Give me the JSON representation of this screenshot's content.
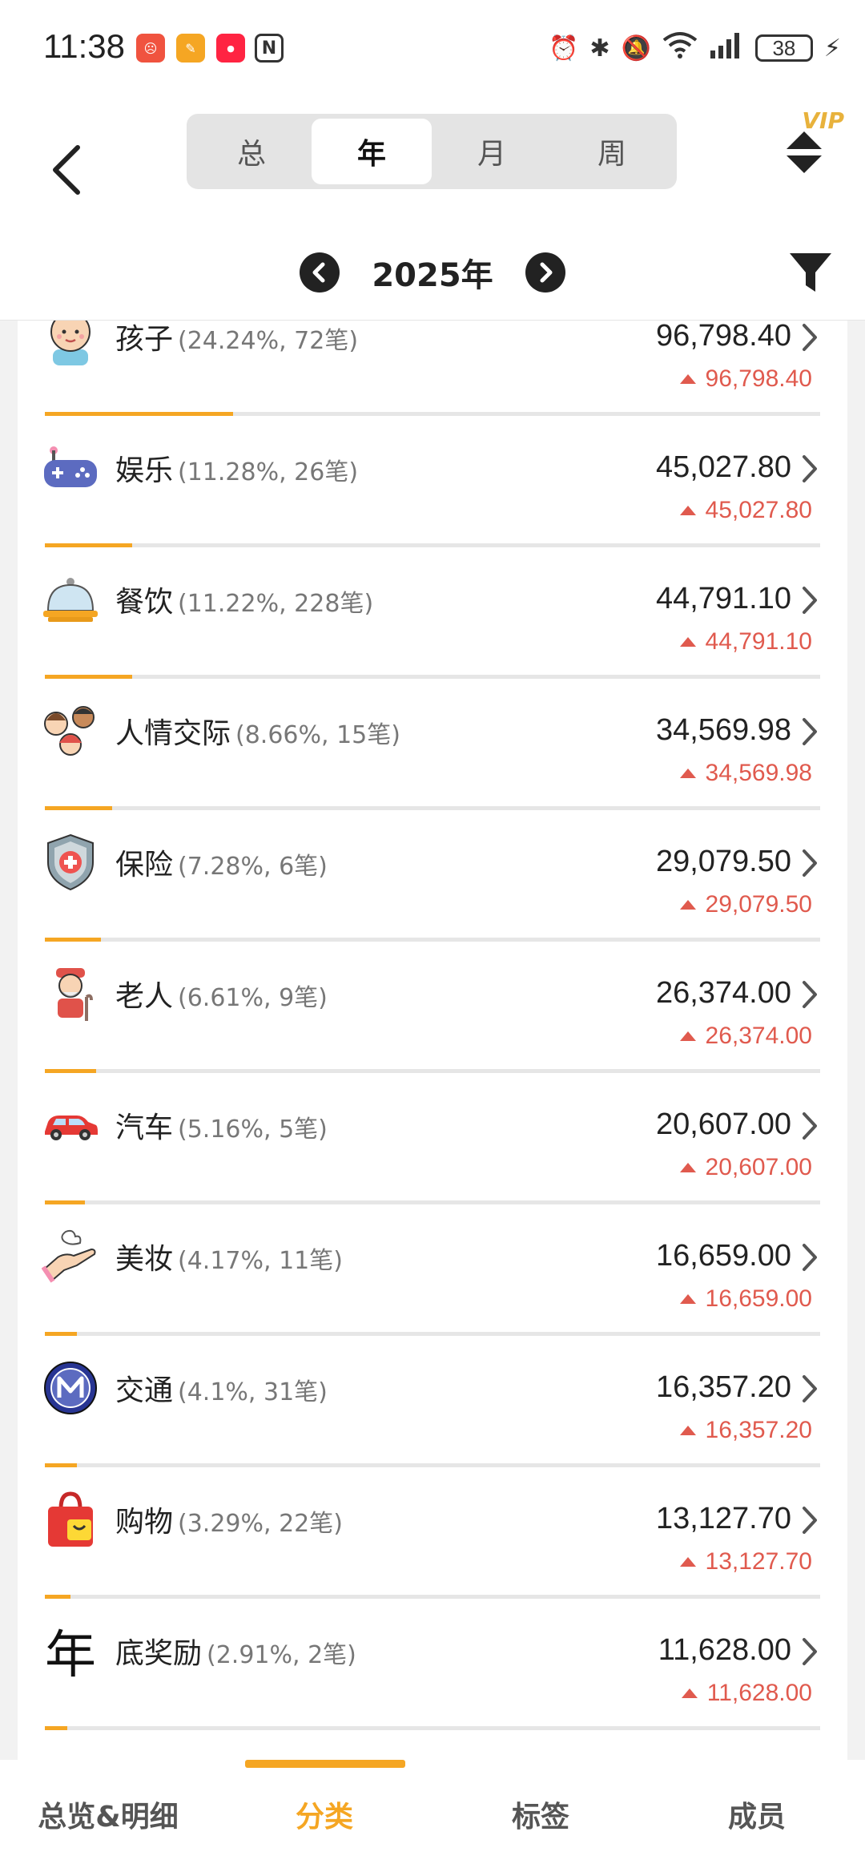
{
  "status_bar": {
    "time": "11:38",
    "battery": "38"
  },
  "header": {
    "period_tabs": [
      {
        "label": "总",
        "active": false
      },
      {
        "label": "年",
        "active": true
      },
      {
        "label": "月",
        "active": false
      },
      {
        "label": "周",
        "active": false
      }
    ],
    "vip_badge": "VIP",
    "year_label": "2025年"
  },
  "colors": {
    "accent": "#f5a623",
    "increase": "#e05a4e"
  },
  "categories": [
    {
      "name": "孩子",
      "meta": "(24.24%, 72笔)",
      "amount": "96,798.40",
      "delta": "96,798.40",
      "share": 0.2424,
      "icon": "baby-icon"
    },
    {
      "name": "娱乐",
      "meta": "(11.28%, 26笔)",
      "amount": "45,027.80",
      "delta": "45,027.80",
      "share": 0.1128,
      "icon": "gamepad-icon"
    },
    {
      "name": "餐饮",
      "meta": "(11.22%, 228笔)",
      "amount": "44,791.10",
      "delta": "44,791.10",
      "share": 0.1122,
      "icon": "food-cloche-icon"
    },
    {
      "name": "人情交际",
      "meta": "(8.66%, 15笔)",
      "amount": "34,569.98",
      "delta": "34,569.98",
      "share": 0.0866,
      "icon": "people-icon"
    },
    {
      "name": "保险",
      "meta": "(7.28%, 6笔)",
      "amount": "29,079.50",
      "delta": "29,079.50",
      "share": 0.0728,
      "icon": "shield-icon"
    },
    {
      "name": "老人",
      "meta": "(6.61%, 9笔)",
      "amount": "26,374.00",
      "delta": "26,374.00",
      "share": 0.0661,
      "icon": "elder-icon"
    },
    {
      "name": "汽车",
      "meta": "(5.16%, 5笔)",
      "amount": "20,607.00",
      "delta": "20,607.00",
      "share": 0.0516,
      "icon": "car-icon"
    },
    {
      "name": "美妆",
      "meta": "(4.17%, 11笔)",
      "amount": "16,659.00",
      "delta": "16,659.00",
      "share": 0.0417,
      "icon": "cosmetics-hand-icon"
    },
    {
      "name": "交通",
      "meta": "(4.1%, 31笔)",
      "amount": "16,357.20",
      "delta": "16,357.20",
      "share": 0.041,
      "icon": "metro-icon"
    },
    {
      "name": "购物",
      "meta": "(3.29%, 22笔)",
      "amount": "13,127.70",
      "delta": "13,127.70",
      "share": 0.0329,
      "icon": "shopping-bag-icon"
    },
    {
      "name": "底奖励",
      "meta": "(2.91%, 2笔)",
      "amount": "11,628.00",
      "delta": "11,628.00",
      "share": 0.0291,
      "icon": "year-char-icon",
      "icon_text": "年"
    }
  ],
  "bottom_nav": [
    {
      "label": "总览&明细",
      "active": false
    },
    {
      "label": "分类",
      "active": true
    },
    {
      "label": "标签",
      "active": false
    },
    {
      "label": "成员",
      "active": false
    }
  ]
}
